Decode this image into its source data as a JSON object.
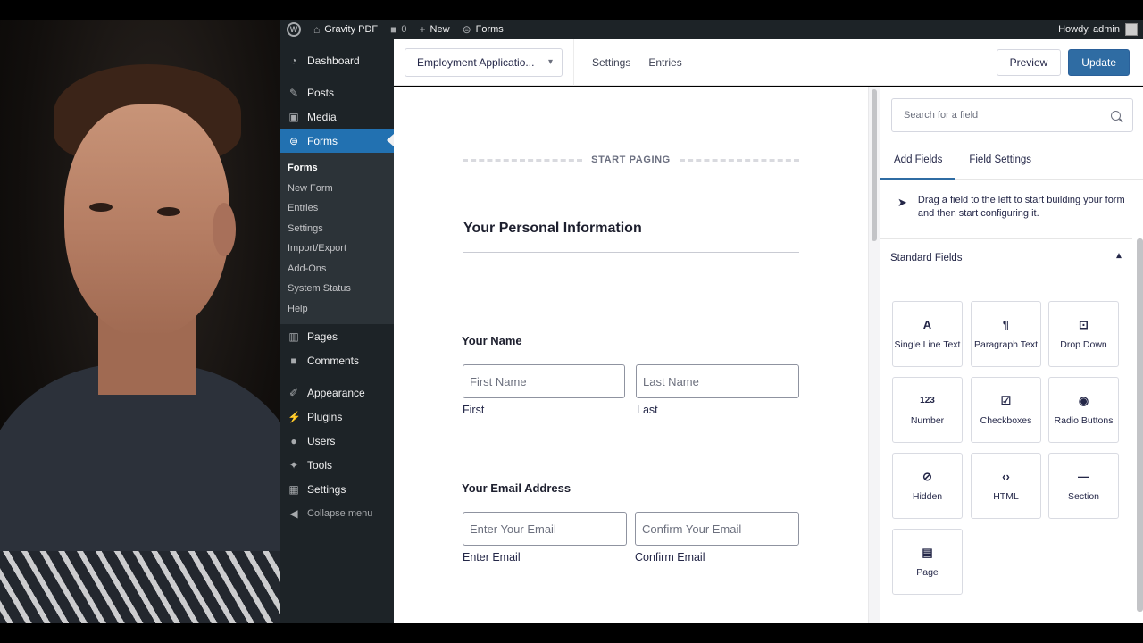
{
  "adminbar": {
    "site": "Gravity PDF",
    "comments": "0",
    "new": "New",
    "forms": "Forms",
    "howdy": "Howdy, admin"
  },
  "menu": {
    "dashboard": "Dashboard",
    "posts": "Posts",
    "media": "Media",
    "forms": "Forms",
    "sub": [
      "Forms",
      "New Form",
      "Entries",
      "Settings",
      "Import/Export",
      "Add-Ons",
      "System Status",
      "Help"
    ],
    "pages": "Pages",
    "comments": "Comments",
    "appearance": "Appearance",
    "plugins": "Plugins",
    "users": "Users",
    "tools": "Tools",
    "settings": "Settings",
    "collapse": "Collapse menu"
  },
  "toolbar": {
    "form_name": "Employment Applicatio...",
    "settings": "Settings",
    "entries": "Entries",
    "preview": "Preview",
    "update": "Update"
  },
  "canvas": {
    "paging": "START PAGING",
    "section_title": "Your Personal Information",
    "name_label": "Your Name",
    "first_placeholder": "First Name",
    "last_placeholder": "Last Name",
    "first_sub": "First",
    "last_sub": "Last",
    "email_label": "Your Email Address",
    "email_placeholder": "Enter Your Email",
    "confirm_placeholder": "Confirm Your Email",
    "email_sub": "Enter Email",
    "confirm_sub": "Confirm Email"
  },
  "panel": {
    "search_placeholder": "Search for a field",
    "tab_add": "Add Fields",
    "tab_settings": "Field Settings",
    "hint": "Drag a field to the left to start building your form and then start configuring it.",
    "standard_fields": "Standard Fields",
    "fields": [
      {
        "label": "Single Line Text",
        "icon": "A"
      },
      {
        "label": "Paragraph Text",
        "icon": "¶"
      },
      {
        "label": "Drop Down",
        "icon": "⊡"
      },
      {
        "label": "Number",
        "icon": "123"
      },
      {
        "label": "Checkboxes",
        "icon": "☑"
      },
      {
        "label": "Radio Buttons",
        "icon": "◉"
      },
      {
        "label": "Hidden",
        "icon": "⊘"
      },
      {
        "label": "HTML",
        "icon": "‹›"
      },
      {
        "label": "Section",
        "icon": "—"
      },
      {
        "label": "Page",
        "icon": "▤"
      }
    ]
  },
  "colors": {
    "wp_dark": "#1d2327",
    "wp_active": "#2271b1",
    "update_btn": "#2f6ca3"
  }
}
